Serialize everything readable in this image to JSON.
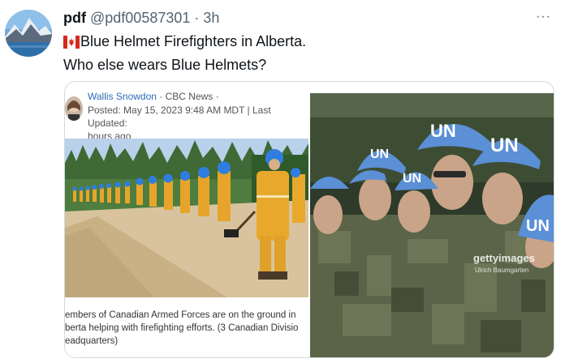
{
  "tweet": {
    "display_name": "pdf",
    "handle": "@pdf00587301",
    "separator": "·",
    "time": "3h",
    "more_icon": "more-dots-icon",
    "flag_icon": "canada-flag-icon",
    "text_line1": "Blue Helmet Firefighters in Alberta.",
    "text_line2": "Who else wears Blue Helmets?"
  },
  "article": {
    "author": "Wallis Snowdon",
    "source": " · CBC News ·",
    "posted": "Posted: May 15, 2023 9:48 AM MDT | Last Updated:",
    "posted2": "hours ago",
    "caption_lines": [
      "embers of Canadian Armed Forces are on the ground in",
      "berta helping with firefighting efforts. (3 Canadian Divisio",
      "eadquarters)"
    ]
  },
  "photo_right": {
    "helmet_text": "UN",
    "credit": "gettyimages",
    "credit_sub": "Ulrich Baumgarten"
  },
  "colors": {
    "text": "#0f1419",
    "muted": "#536471",
    "border": "#cfd9de",
    "link": "#2b6cb8",
    "un_blue": "#5b8fd6",
    "firefighter_yellow": "#e6a52a"
  }
}
